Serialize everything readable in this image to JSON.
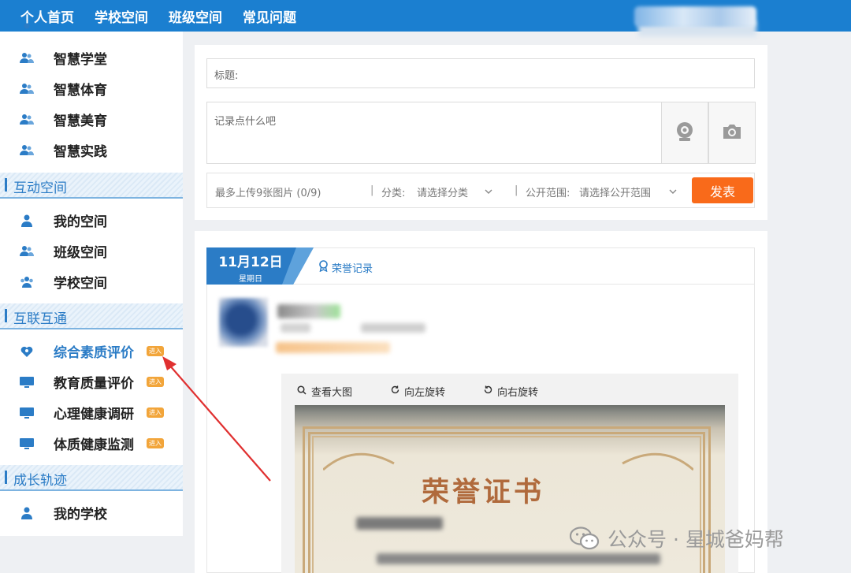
{
  "nav": {
    "items": [
      "个人首页",
      "学校空间",
      "班级空间",
      "常见问题"
    ]
  },
  "sidebar": {
    "top_items": [
      "智慧学堂",
      "智慧体育",
      "智慧美育",
      "智慧实践"
    ],
    "sections": [
      {
        "title": "互动空间",
        "items": [
          "我的空间",
          "班级空间",
          "学校空间"
        ]
      },
      {
        "title": "互联互通",
        "items": [
          "综合素质评价",
          "教育质量评价",
          "心理健康调研",
          "体质健康监测"
        ],
        "badge": "进入"
      },
      {
        "title": "成长轨迹",
        "items": [
          "我的学校"
        ]
      }
    ]
  },
  "composer": {
    "title_placeholder": "标题:",
    "content_placeholder": "记录点什么吧",
    "upload_hint": "最多上传9张图片 (0/9)",
    "category_label": "分类:",
    "category_value": "请选择分类",
    "scope_label": "公开范围:",
    "scope_value": "请选择公开范围",
    "post_button": "发表"
  },
  "feed": {
    "date": "11月12日",
    "weekday": "星期日",
    "tab_honor": "荣誉记录",
    "photo_tools": [
      "查看大图",
      "向左旋转",
      "向右旋转"
    ],
    "certificate_title": "荣誉证书"
  },
  "watermark": "公众号 · 星城爸妈帮",
  "colors": {
    "nav_bg": "#1b7fd0",
    "accent": "#2b7cc6",
    "post_button": "#f96a1a",
    "badge": "#f2a53a",
    "arrow": "#e03030"
  }
}
